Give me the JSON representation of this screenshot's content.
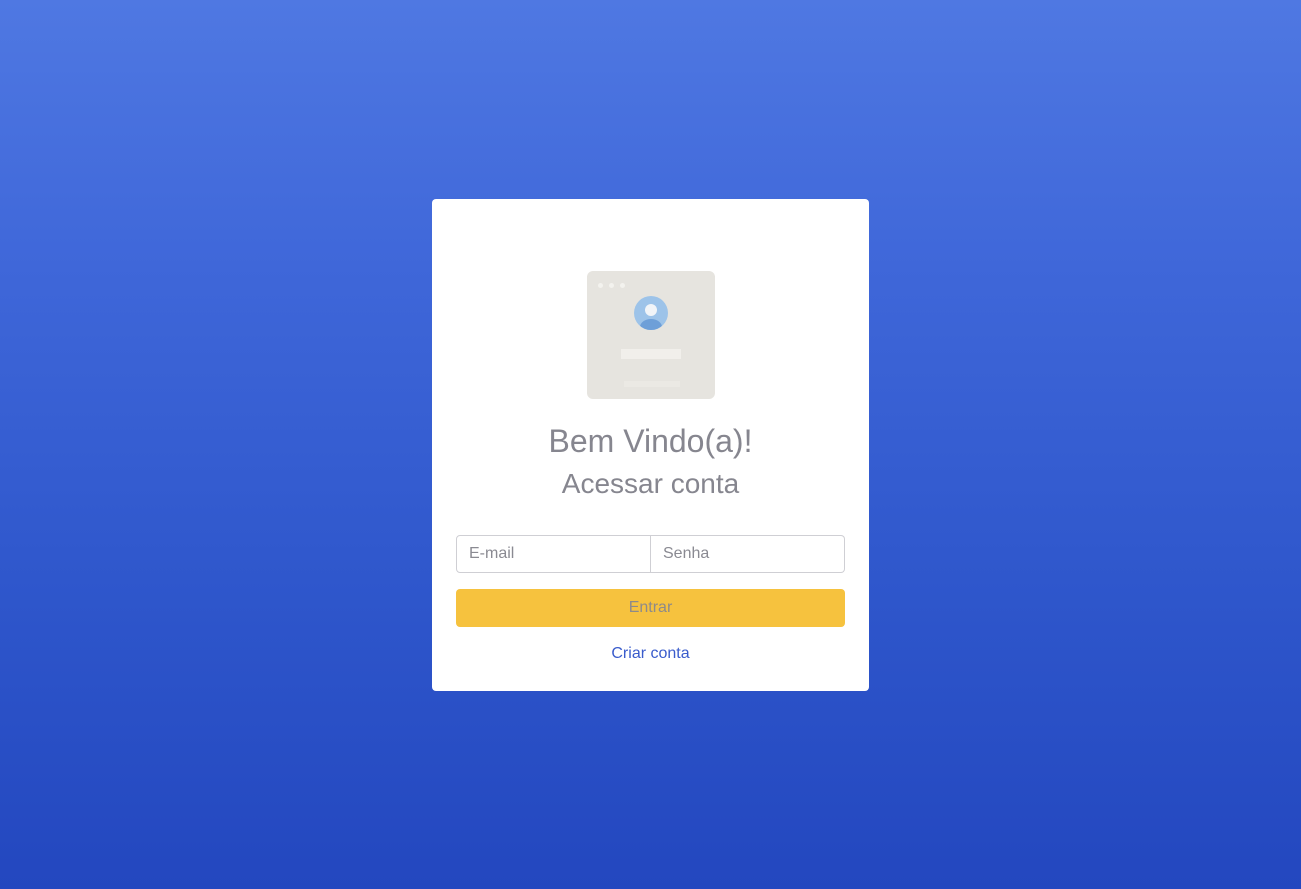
{
  "login": {
    "title": "Bem Vindo(a)!",
    "subtitle": "Acessar conta",
    "email_placeholder": "E-mail",
    "email_value": "",
    "password_placeholder": "Senha",
    "password_value": "",
    "submit_label": "Entrar",
    "create_account_label": "Criar conta"
  },
  "illustration": {
    "icon": "login-window-user-icon"
  },
  "colors": {
    "background_top": "#4f78e2",
    "background_bottom": "#2347bf",
    "card": "#ffffff",
    "button": "#f6c23e",
    "link": "#3a5ccc",
    "heading_text": "#86868f"
  }
}
